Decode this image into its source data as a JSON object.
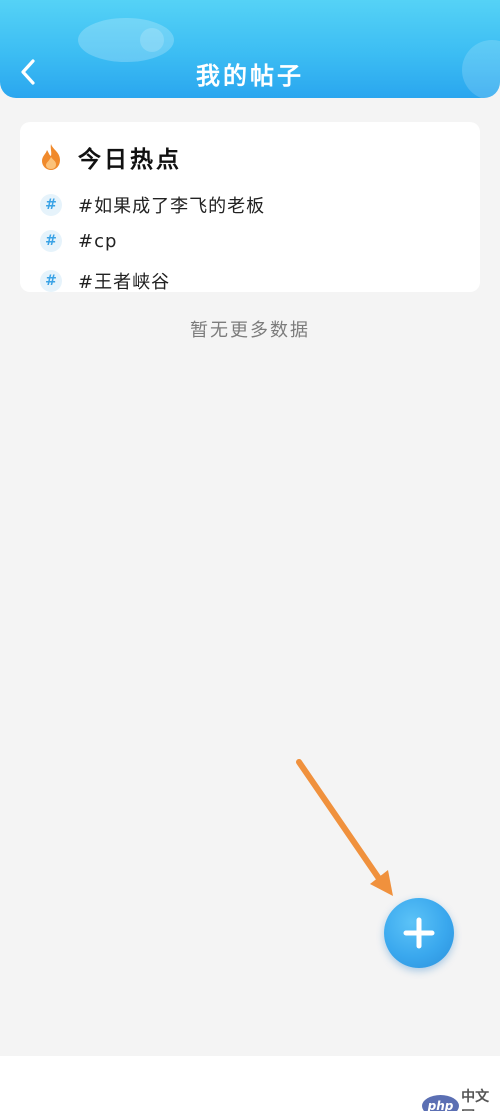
{
  "header": {
    "title": "我的帖子",
    "back_icon": "chevron-left-icon"
  },
  "hot_topics": {
    "icon": "flame-icon",
    "title": "今日热点",
    "badge_symbol": "#",
    "items": [
      {
        "label": "#如果成了李飞的老板"
      },
      {
        "label": "#cp"
      },
      {
        "label": "#王者峡谷"
      }
    ]
  },
  "status": {
    "no_more_text": "暂无更多数据"
  },
  "fab": {
    "icon": "plus-icon"
  },
  "watermark": {
    "logo_text": "php",
    "site_text": "中文网"
  },
  "colors": {
    "header_gradient_top": "#55d2f6",
    "header_gradient_bottom": "#2aa6ef",
    "flame": "#f08a2c",
    "topic_badge": "#3aa3e6",
    "fab": "#3aa8ee",
    "annotation_arrow": "#f0913d",
    "background": "#f4f4f4"
  }
}
